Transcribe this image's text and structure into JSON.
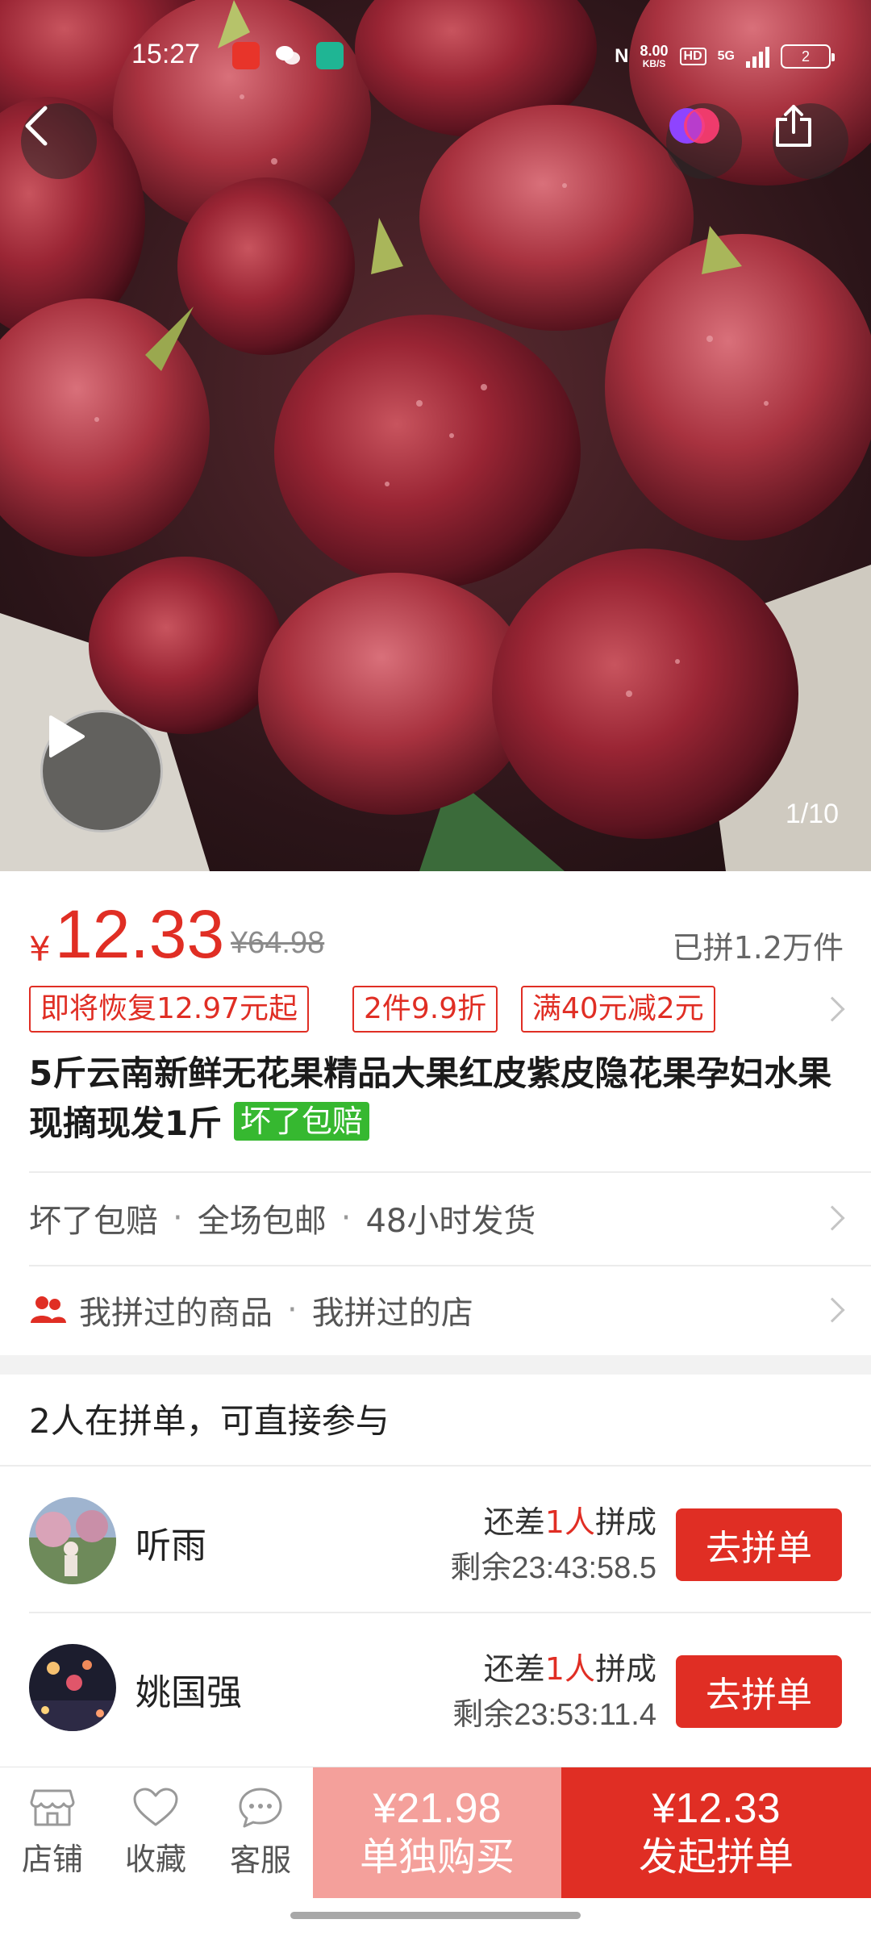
{
  "status_bar": {
    "time": "15:27",
    "speed_value": "8.00",
    "speed_unit": "KB/S",
    "hd": "HD",
    "network": "5G",
    "battery": "2"
  },
  "hero": {
    "counter": "1/10"
  },
  "product": {
    "currency_symbol": "¥",
    "price": "12.33",
    "original_price": "¥64.98",
    "sold_count": "已拼1.2万件",
    "tags": [
      "即将恢复12.97元起",
      "2件9.9折",
      "满40元减2元"
    ],
    "title": "5斤云南新鲜无花果精品大果红皮紫皮隐花果孕妇水果现摘现发1斤",
    "badge": "坏了包赔"
  },
  "services": {
    "items": [
      "坏了包赔",
      "全场包邮",
      "48小时发货"
    ]
  },
  "history": {
    "items": [
      "我拼过的商品",
      "我拼过的店"
    ]
  },
  "group_buy": {
    "header": "2人在拼单，可直接参与",
    "rows": [
      {
        "name": "听雨",
        "need_prefix": "还差",
        "need_count": "1人",
        "need_suffix": "拼成",
        "timer": "剩余23:43:58.5",
        "button": "去拼单"
      },
      {
        "name": "姚国强",
        "need_prefix": "还差",
        "need_count": "1人",
        "need_suffix": "拼成",
        "timer": "剩余23:53:11.4",
        "button": "去拼单"
      }
    ]
  },
  "bottom_bar": {
    "store": "店铺",
    "favorite": "收藏",
    "service": "客服",
    "single_price": "¥21.98",
    "single_label": "单独购买",
    "group_price": "¥12.33",
    "group_label": "发起拼单"
  },
  "colors": {
    "accent": "#e02e24",
    "accent_light": "#f4a09b",
    "badge_green": "#36b830"
  }
}
